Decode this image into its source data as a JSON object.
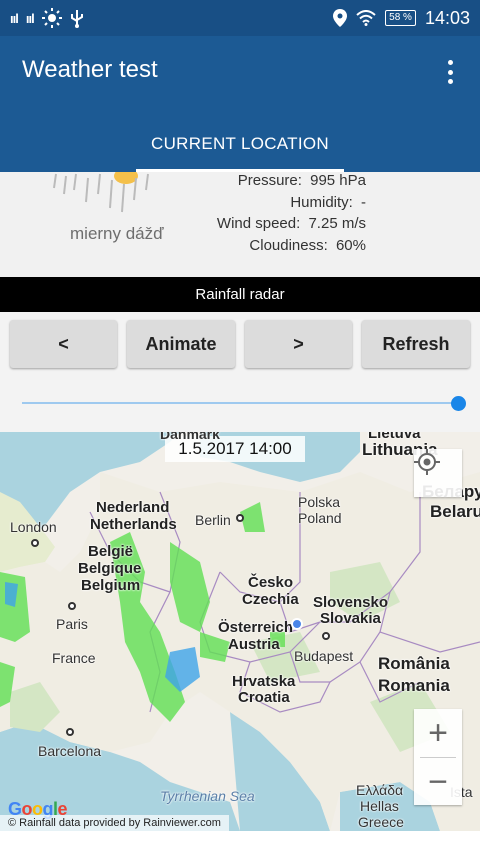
{
  "status_bar": {
    "signal1": "ııl",
    "signal2": "ııl",
    "battery": "58 %",
    "time": "14:03"
  },
  "app_bar": {
    "title": "Weather test",
    "tab_label": "CURRENT LOCATION"
  },
  "weather": {
    "description": "mierny dážď",
    "stats": [
      {
        "label": "Pressure:",
        "value": "995 hPa"
      },
      {
        "label": "Humidity:",
        "value": "-"
      },
      {
        "label": "Wind speed:",
        "value": "7.25 m/s"
      },
      {
        "label": "Cloudiness:",
        "value": "60%"
      }
    ]
  },
  "radar": {
    "header": "Rainfall radar",
    "buttons": {
      "prev": "<",
      "animate": "Animate",
      "next": ">",
      "refresh": "Refresh"
    },
    "slider_fraction": 1.0
  },
  "map": {
    "timestamp": "1.5.2017 14:00",
    "labels": {
      "danmark": "Danmark",
      "lietuva": "Lietuva",
      "lithuania": "Lithuania",
      "nederland": "Nederland",
      "netherlands": "Netherlands",
      "london": "London",
      "berlin": "Berlin",
      "polska": "Polska",
      "poland": "Poland",
      "belarus_cyr": "Белару",
      "belarus": "Belaru",
      "belgie": "België",
      "belgique": "Belgique",
      "belgium": "Belgium",
      "paris": "Paris",
      "cesko": "Česko",
      "czechia": "Czechia",
      "slovensko": "Slovensko",
      "slovakia": "Slovakia",
      "osterreich": "Österreich",
      "austria": "Austria",
      "france": "France",
      "budapest": "Budapest",
      "romania_local": "România",
      "romania": "Romania",
      "hrvatska": "Hrvatska",
      "croatia": "Croatia",
      "barcelona": "Barcelona",
      "tyrrhenian": "Tyrrhenian Sea",
      "ellada": "Ελλάδα",
      "hellas": "Hellas",
      "greece": "Greece",
      "istanbul": "Ista"
    },
    "zoom_in": "+",
    "zoom_out": "−",
    "google": [
      "G",
      "o",
      "o",
      "g",
      "l",
      "e"
    ],
    "attribution": "© Rainfall data provided by Rainviewer.com"
  },
  "colors": {
    "status_bar": "#184f85",
    "app_bar": "#1c5a94",
    "slider_thumb": "#1a86e8"
  }
}
